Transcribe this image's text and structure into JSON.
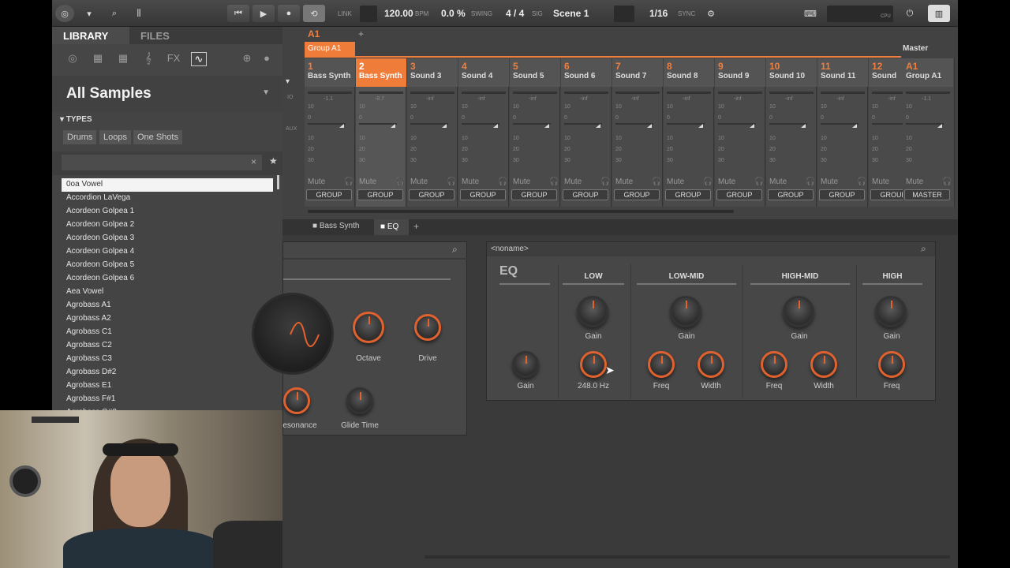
{
  "topbar": {
    "link_label": "LINK",
    "tempo": "120.00",
    "tempo_unit": "BPM",
    "swing": "0.0 %",
    "swing_label": "SWING",
    "signature": "4 / 4",
    "signature_label": "SIG",
    "scene": "Scene 1",
    "quantize": "1/16",
    "sync_label": "SYNC",
    "cpu_label": "CPU"
  },
  "library": {
    "tabs": [
      "LIBRARY",
      "FILES"
    ],
    "title": "All Samples",
    "types_label": "TYPES",
    "type_tags": [
      "Drums",
      "Loops",
      "One Shots"
    ],
    "samples": [
      "0oa Vowel",
      "Accordion LaVega",
      "Acordeon Golpea 1",
      "Acordeon Golpea 2",
      "Acordeon Golpea 3",
      "Acordeon Golpea 4",
      "Acordeon Golpea 5",
      "Acordeon Golpea 6",
      "Aea Vowel",
      "Agrobass A1",
      "Agrobass A2",
      "Agrobass C1",
      "Agrobass C2",
      "Agrobass C3",
      "Agrobass D#2",
      "Agrobass E1",
      "Agrobass F#1",
      "Agrobass G#2"
    ]
  },
  "mixer": {
    "group_tab": "A1",
    "group_name": "Group A1",
    "add_label": "+",
    "master_label": "Master",
    "io_label": "IO",
    "aux_label": "AUX",
    "mute_label": "Mute",
    "group_button": "GROUP",
    "master_button": "MASTER",
    "channels": [
      {
        "num": "1",
        "name": "Bass Synth",
        "level": "-1.1"
      },
      {
        "num": "2",
        "name": "Bass Synth",
        "level": "-8.7"
      },
      {
        "num": "3",
        "name": "Sound 3",
        "level": "-inf"
      },
      {
        "num": "4",
        "name": "Sound 4",
        "level": "-inf"
      },
      {
        "num": "5",
        "name": "Sound 5",
        "level": "-inf"
      },
      {
        "num": "6",
        "name": "Sound 6",
        "level": "-inf"
      },
      {
        "num": "7",
        "name": "Sound 7",
        "level": "-inf"
      },
      {
        "num": "8",
        "name": "Sound 8",
        "level": "-inf"
      },
      {
        "num": "9",
        "name": "Sound 9",
        "level": "-inf"
      },
      {
        "num": "10",
        "name": "Sound 10",
        "level": "-inf"
      },
      {
        "num": "11",
        "name": "Sound 11",
        "level": "-inf"
      },
      {
        "num": "12",
        "name": "Sound",
        "level": "-inf"
      }
    ],
    "master_channel": {
      "num": "A1",
      "name": "Group A1",
      "level": "-1.1"
    },
    "scale": [
      "10",
      "0",
      "10",
      "20",
      "30"
    ]
  },
  "plugin_tabs": {
    "sound_tab": "Bass Synth",
    "eq_tab": "EQ",
    "add": "+"
  },
  "synth_panel": {
    "octave": "Octave",
    "drive": "Drive",
    "resonance": "esonance",
    "glide": "Glide Time"
  },
  "eq_panel": {
    "preset": "<noname>",
    "title": "EQ",
    "bands": [
      "LOW",
      "LOW-MID",
      "HIGH-MID",
      "HIGH"
    ],
    "gain_label": "Gain",
    "freq_label": "Freq",
    "width_label": "Width",
    "low_freq_value": "248.0 Hz"
  },
  "colors": {
    "accent": "#f07c3a",
    "bg": "#3a3a3a"
  }
}
